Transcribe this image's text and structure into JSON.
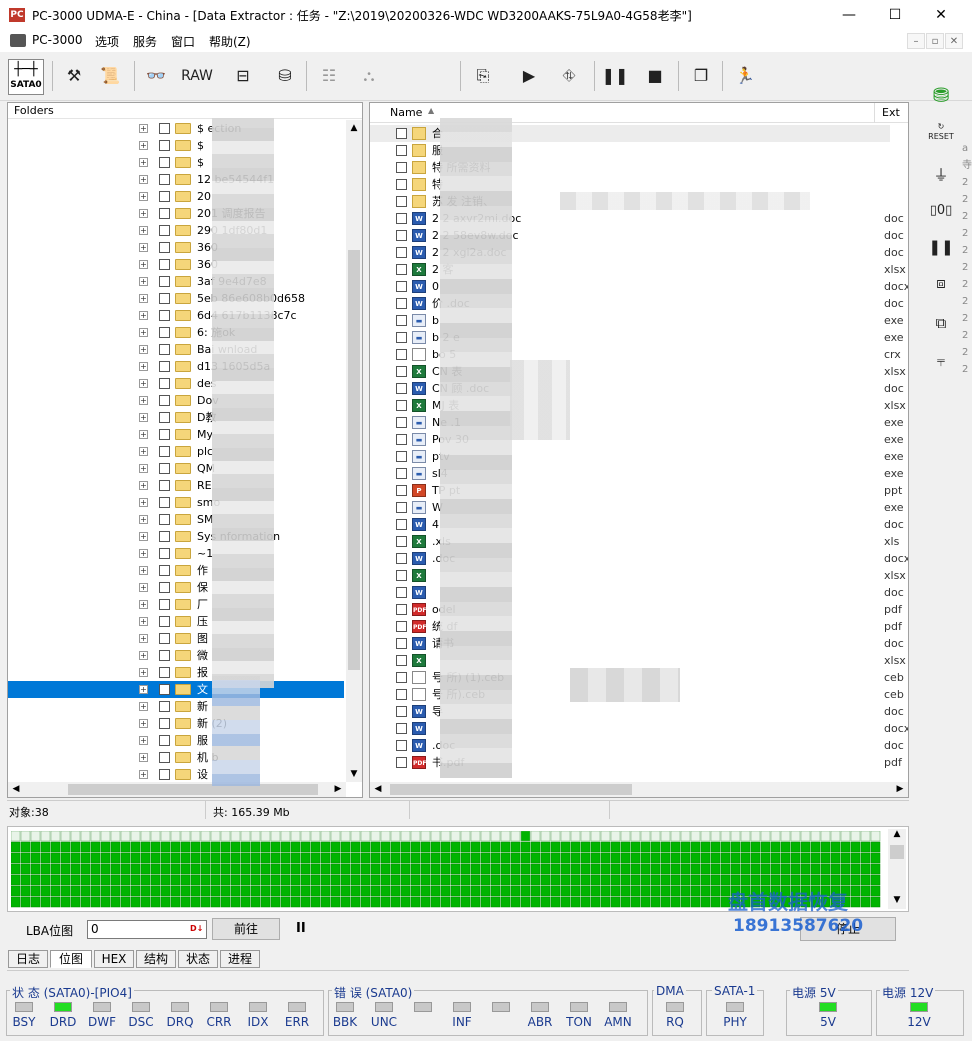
{
  "window": {
    "title": "PC-3000 UDMA-E - China - [Data Extractor : 任务 - \"Z:\\2019\\20200326-WDC WD3200AAKS-75L9A0-4G58老李\"]",
    "app_icon": "PC",
    "minimize": "—",
    "maximize": "☐",
    "close": "✕"
  },
  "menu": {
    "items": [
      "PC-3000",
      "选项",
      "服务",
      "窗口",
      "帮助(Z)"
    ]
  },
  "mdi_controls": [
    "–",
    "▫",
    "✕"
  ],
  "toolbar": {
    "sata_label": "SATA0",
    "raw_label": "RAW"
  },
  "folders": {
    "header": "Folders",
    "rows": [
      {
        "label": "$ ection"
      },
      {
        "label": "$"
      },
      {
        "label": "$"
      },
      {
        "label": "12 be54544f1"
      },
      {
        "label": "20"
      },
      {
        "label": "201 调度报告"
      },
      {
        "label": "290 1df80d1"
      },
      {
        "label": "360"
      },
      {
        "label": "360"
      },
      {
        "label": "3af 9e4d7e8"
      },
      {
        "label": "5eb 86e608b0d658"
      },
      {
        "label": "6d4 617b1138c7c"
      },
      {
        "label": "6: 施ok"
      },
      {
        "label": "Bai wnload"
      },
      {
        "label": "d13 1605d5a"
      },
      {
        "label": "des"
      },
      {
        "label": "Dov"
      },
      {
        "label": "D教"
      },
      {
        "label": "My"
      },
      {
        "label": "plc"
      },
      {
        "label": "QM"
      },
      {
        "label": "RE"
      },
      {
        "label": "smo"
      },
      {
        "label": "SM"
      },
      {
        "label": "Sys nformation"
      },
      {
        "label": "~1"
      },
      {
        "label": "作"
      },
      {
        "label": "保"
      },
      {
        "label": "厂"
      },
      {
        "label": "压"
      },
      {
        "label": "图"
      },
      {
        "label": "微"
      },
      {
        "label": "报"
      },
      {
        "label": "文",
        "selected": true
      },
      {
        "label": "新"
      },
      {
        "label": "新 (2)"
      },
      {
        "label": "服"
      },
      {
        "label": "机 b"
      },
      {
        "label": "设"
      }
    ]
  },
  "files": {
    "col_name": "Name",
    "col_ext": "Ext",
    "rows": [
      {
        "name": "合",
        "ext": "",
        "type": "folder"
      },
      {
        "name": "服",
        "ext": "",
        "type": "folder"
      },
      {
        "name": "特 所需资料",
        "ext": "",
        "type": "folder"
      },
      {
        "name": "特",
        "ext": "",
        "type": "folder"
      },
      {
        "name": "苏 发 注销、",
        "ext": "",
        "type": "folder"
      },
      {
        "name": "2 2 axvr2mi.doc",
        "ext": "doc",
        "type": "doc"
      },
      {
        "name": "2 2 58ev8w.doc",
        "ext": "doc",
        "type": "doc"
      },
      {
        "name": "2 2 xgi2a.doc",
        "ext": "doc",
        "type": "doc"
      },
      {
        "name": "2 客",
        "ext": "xlsx",
        "type": "xls"
      },
      {
        "name": "0",
        "ext": "docx",
        "type": "doc"
      },
      {
        "name": "价 .doc",
        "ext": "doc",
        "type": "doc"
      },
      {
        "name": "b",
        "ext": "exe",
        "type": "exe"
      },
      {
        "name": "b 2 e",
        "ext": "exe",
        "type": "exe"
      },
      {
        "name": "bo 5",
        "ext": "crx",
        "type": "blank"
      },
      {
        "name": "CN 表",
        "ext": "xlsx",
        "type": "xls"
      },
      {
        "name": "CN 顾 .doc",
        "ext": "doc",
        "type": "doc"
      },
      {
        "name": "MJ 表",
        "ext": "xlsx",
        "type": "xls"
      },
      {
        "name": "Ne .1",
        "ext": "exe",
        "type": "exe"
      },
      {
        "name": "Pov 30",
        "ext": "exe",
        "type": "exe"
      },
      {
        "name": "ptv",
        "ext": "exe",
        "type": "exe"
      },
      {
        "name": "sl4",
        "ext": "exe",
        "type": "exe"
      },
      {
        "name": "TP pt",
        "ext": "ppt",
        "type": "ppt"
      },
      {
        "name": "W",
        "ext": "exe",
        "type": "exe"
      },
      {
        "name": "4",
        "ext": "doc",
        "type": "doc"
      },
      {
        "name": ".xls",
        "ext": "xls",
        "type": "xls"
      },
      {
        "name": ".doc",
        "ext": "docx",
        "type": "doc"
      },
      {
        "name": "",
        "ext": "xlsx",
        "type": "xls"
      },
      {
        "name": "",
        "ext": "doc",
        "type": "doc"
      },
      {
        "name": "odel",
        "ext": "pdf",
        "type": "pdf"
      },
      {
        "name": "统 df",
        "ext": "pdf",
        "type": "pdf"
      },
      {
        "name": "请书",
        "ext": "doc",
        "type": "doc"
      },
      {
        "name": "",
        "ext": "xlsx",
        "type": "xls"
      },
      {
        "name": "号 所) (1).ceb",
        "ext": "ceb",
        "type": "blank"
      },
      {
        "name": "号 所).ceb",
        "ext": "ceb",
        "type": "blank"
      },
      {
        "name": "导",
        "ext": "doc",
        "type": "doc"
      },
      {
        "name": "",
        "ext": "docx",
        "type": "doc"
      },
      {
        "name": ".doc",
        "ext": "doc",
        "type": "doc"
      },
      {
        "name": "书.pdf",
        "ext": "pdf",
        "type": "pdf"
      }
    ]
  },
  "status": {
    "objects": "对象:38",
    "total": "共: 165.39 Mb"
  },
  "lba": {
    "label": "LBA位图",
    "value": "0",
    "go_button": "前往",
    "pause": "II",
    "stop_button": "停止"
  },
  "watermark": {
    "line1": "盘首数据恢复",
    "line2": "18913587620"
  },
  "tabs": [
    "日志",
    "位图",
    "HEX",
    "结构",
    "状态",
    "进程"
  ],
  "active_tab": "位图",
  "indicators": {
    "status_group": "状 态 (SATA0)-[PIO4]",
    "status_leds": [
      {
        "label": "BSY",
        "on": false
      },
      {
        "label": "DRD",
        "on": true
      },
      {
        "label": "DWF",
        "on": false
      },
      {
        "label": "DSC",
        "on": false
      },
      {
        "label": "DRQ",
        "on": false
      },
      {
        "label": "CRR",
        "on": false
      },
      {
        "label": "IDX",
        "on": false
      },
      {
        "label": "ERR",
        "on": false
      }
    ],
    "error_group": "错 误 (SATA0)",
    "error_leds": [
      {
        "label": "BBK",
        "on": false
      },
      {
        "label": "UNC",
        "on": false
      },
      {
        "label": "",
        "on": false
      },
      {
        "label": "INF",
        "on": false
      },
      {
        "label": "",
        "on": false
      },
      {
        "label": "ABR",
        "on": false
      },
      {
        "label": "TON",
        "on": false
      },
      {
        "label": "AMN",
        "on": false
      }
    ],
    "dma_group": "DMA",
    "dma_led": {
      "label": "RQ",
      "on": false
    },
    "sata_group": "SATA-1",
    "sata_led": {
      "label": "PHY",
      "on": false
    },
    "power5_group": "电源 5V",
    "power5_led": {
      "label": "5V",
      "on": true
    },
    "power12_group": "电源 12V",
    "power12_led": {
      "label": "12V",
      "on": true
    }
  },
  "colors": {
    "selection": "#0078d7",
    "led_on": "#22dd22",
    "block_ok": "#00aa00",
    "watermark": "#1a5fd0"
  }
}
